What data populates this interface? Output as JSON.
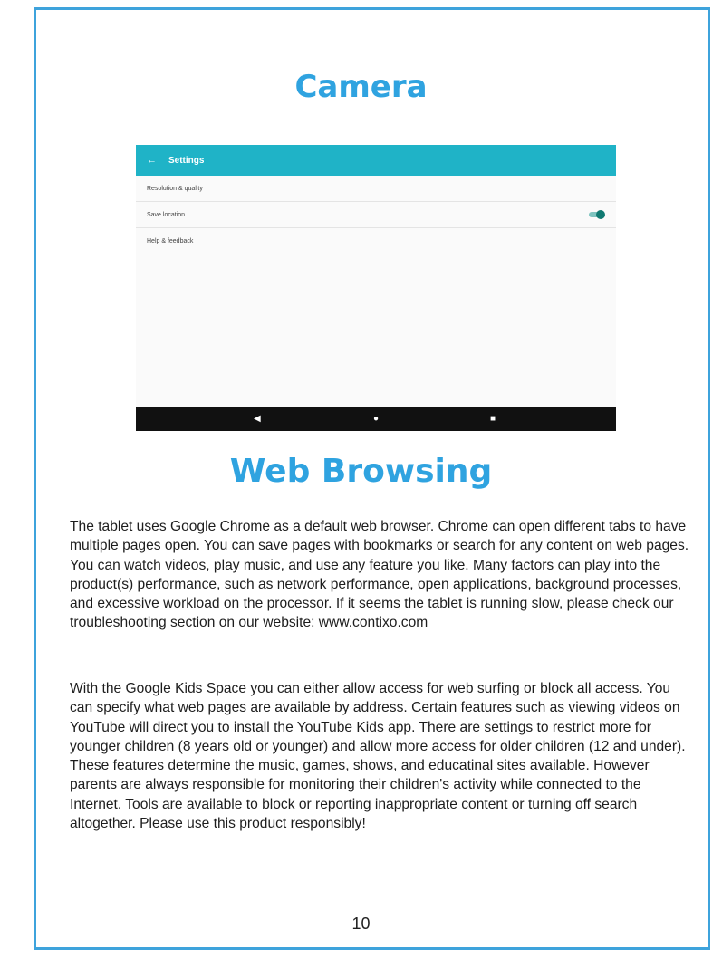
{
  "headings": {
    "camera": "Camera",
    "web_browsing": "Web Browsing"
  },
  "screenshot": {
    "back_icon": "←",
    "title": "Settings",
    "rows": [
      "Resolution & quality",
      "Save location",
      "Help & feedback"
    ],
    "toggle_state": "on",
    "nav_back": "◀",
    "nav_home": "●",
    "nav_recent": "■",
    "accent_color": "#1fb3c7"
  },
  "paragraphs": [
    "The tablet uses Google Chrome as a default web browser. Chrome can open different tabs to have multiple pages open.  You can save pages with bookmarks or search for any content on web pages. You can watch videos, play music, and use any feature you like. Many factors can play into the product(s) performance, such as network performance, open applications, background processes, and excessive workload on the processor. If it seems the tablet is running slow, please check our troubleshooting section on our website: www.contixo.com",
    "With the Google Kids Space you can either allow access for web surfing or block all access. You can specify what web pages are available by address. Certain features such as viewing videos on YouTube will direct you to install the YouTube Kids app. There are settings to restrict more for younger children (8 years old or younger) and allow more access for older children (12 and under). These features determine the music, games, shows, and educatinal sites available. However parents are always responsible for monitoring their children's activity while connected to the Internet. Tools are available to block or reporting inappropriate content or turning off search altogether. Please use this product responsibly!"
  ],
  "page_number": "10",
  "colors": {
    "border": "#3ea3dc",
    "heading": "#2fa3e0"
  }
}
